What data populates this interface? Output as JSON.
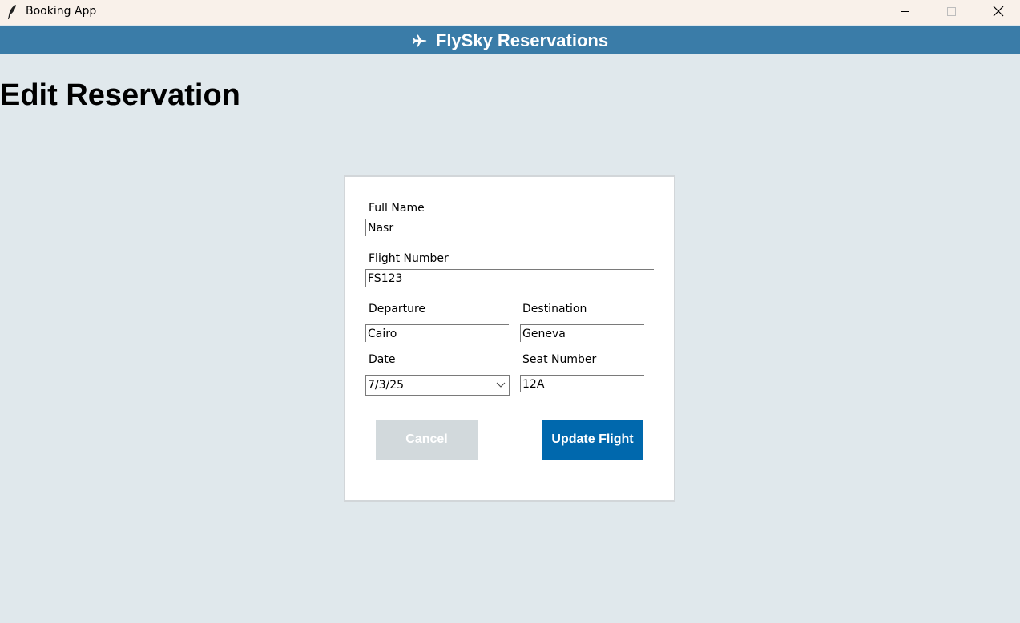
{
  "window": {
    "title": "Booking App"
  },
  "header": {
    "title": "FlySky Reservations",
    "icon": "airplane-icon",
    "color": "#3a7ca8"
  },
  "page": {
    "title": "Edit Reservation"
  },
  "form": {
    "full_name": {
      "label": "Full Name",
      "value": "Nasr"
    },
    "flight_number": {
      "label": "Flight Number",
      "value": "FS123"
    },
    "departure": {
      "label": "Departure",
      "value": "Cairo"
    },
    "destination": {
      "label": "Destination",
      "value": "Geneva"
    },
    "date": {
      "label": "Date",
      "value": "7/3/25"
    },
    "seat_number": {
      "label": "Seat Number",
      "value": "12A"
    },
    "cancel_label": "Cancel",
    "update_label": "Update Flight",
    "update_color": "#0068ad",
    "cancel_color": "#d2d9dc"
  }
}
